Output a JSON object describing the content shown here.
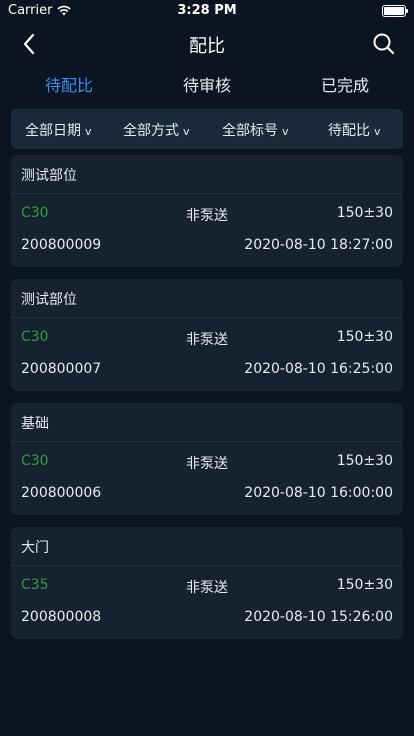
{
  "status_bar": {
    "carrier": "Carrier",
    "time": "3:28 PM"
  },
  "nav": {
    "title": "配比"
  },
  "tabs": [
    {
      "label": "待配比",
      "active": true
    },
    {
      "label": "待审核",
      "active": false
    },
    {
      "label": "已完成",
      "active": false
    }
  ],
  "filters": [
    {
      "label": "全部日期"
    },
    {
      "label": "全部方式"
    },
    {
      "label": "全部标号"
    },
    {
      "label": "待配比"
    }
  ],
  "colors": {
    "active_tab": "#3d8bf0",
    "grade": "#2e9b3a",
    "background": "#0b1521",
    "card": "#16222f"
  },
  "records": [
    {
      "part": "测试部位",
      "grade": "C30",
      "pump": "非泵送",
      "slump": "150±30",
      "code": "200800009",
      "time": "2020-08-10 18:27:00"
    },
    {
      "part": "测试部位",
      "grade": "C30",
      "pump": "非泵送",
      "slump": "150±30",
      "code": "200800007",
      "time": "2020-08-10 16:25:00"
    },
    {
      "part": "基础",
      "grade": "C30",
      "pump": "非泵送",
      "slump": "150±30",
      "code": "200800006",
      "time": "2020-08-10 16:00:00"
    },
    {
      "part": "大门",
      "grade": "C35",
      "pump": "非泵送",
      "slump": "150±30",
      "code": "200800008",
      "time": "2020-08-10 15:26:00"
    }
  ]
}
